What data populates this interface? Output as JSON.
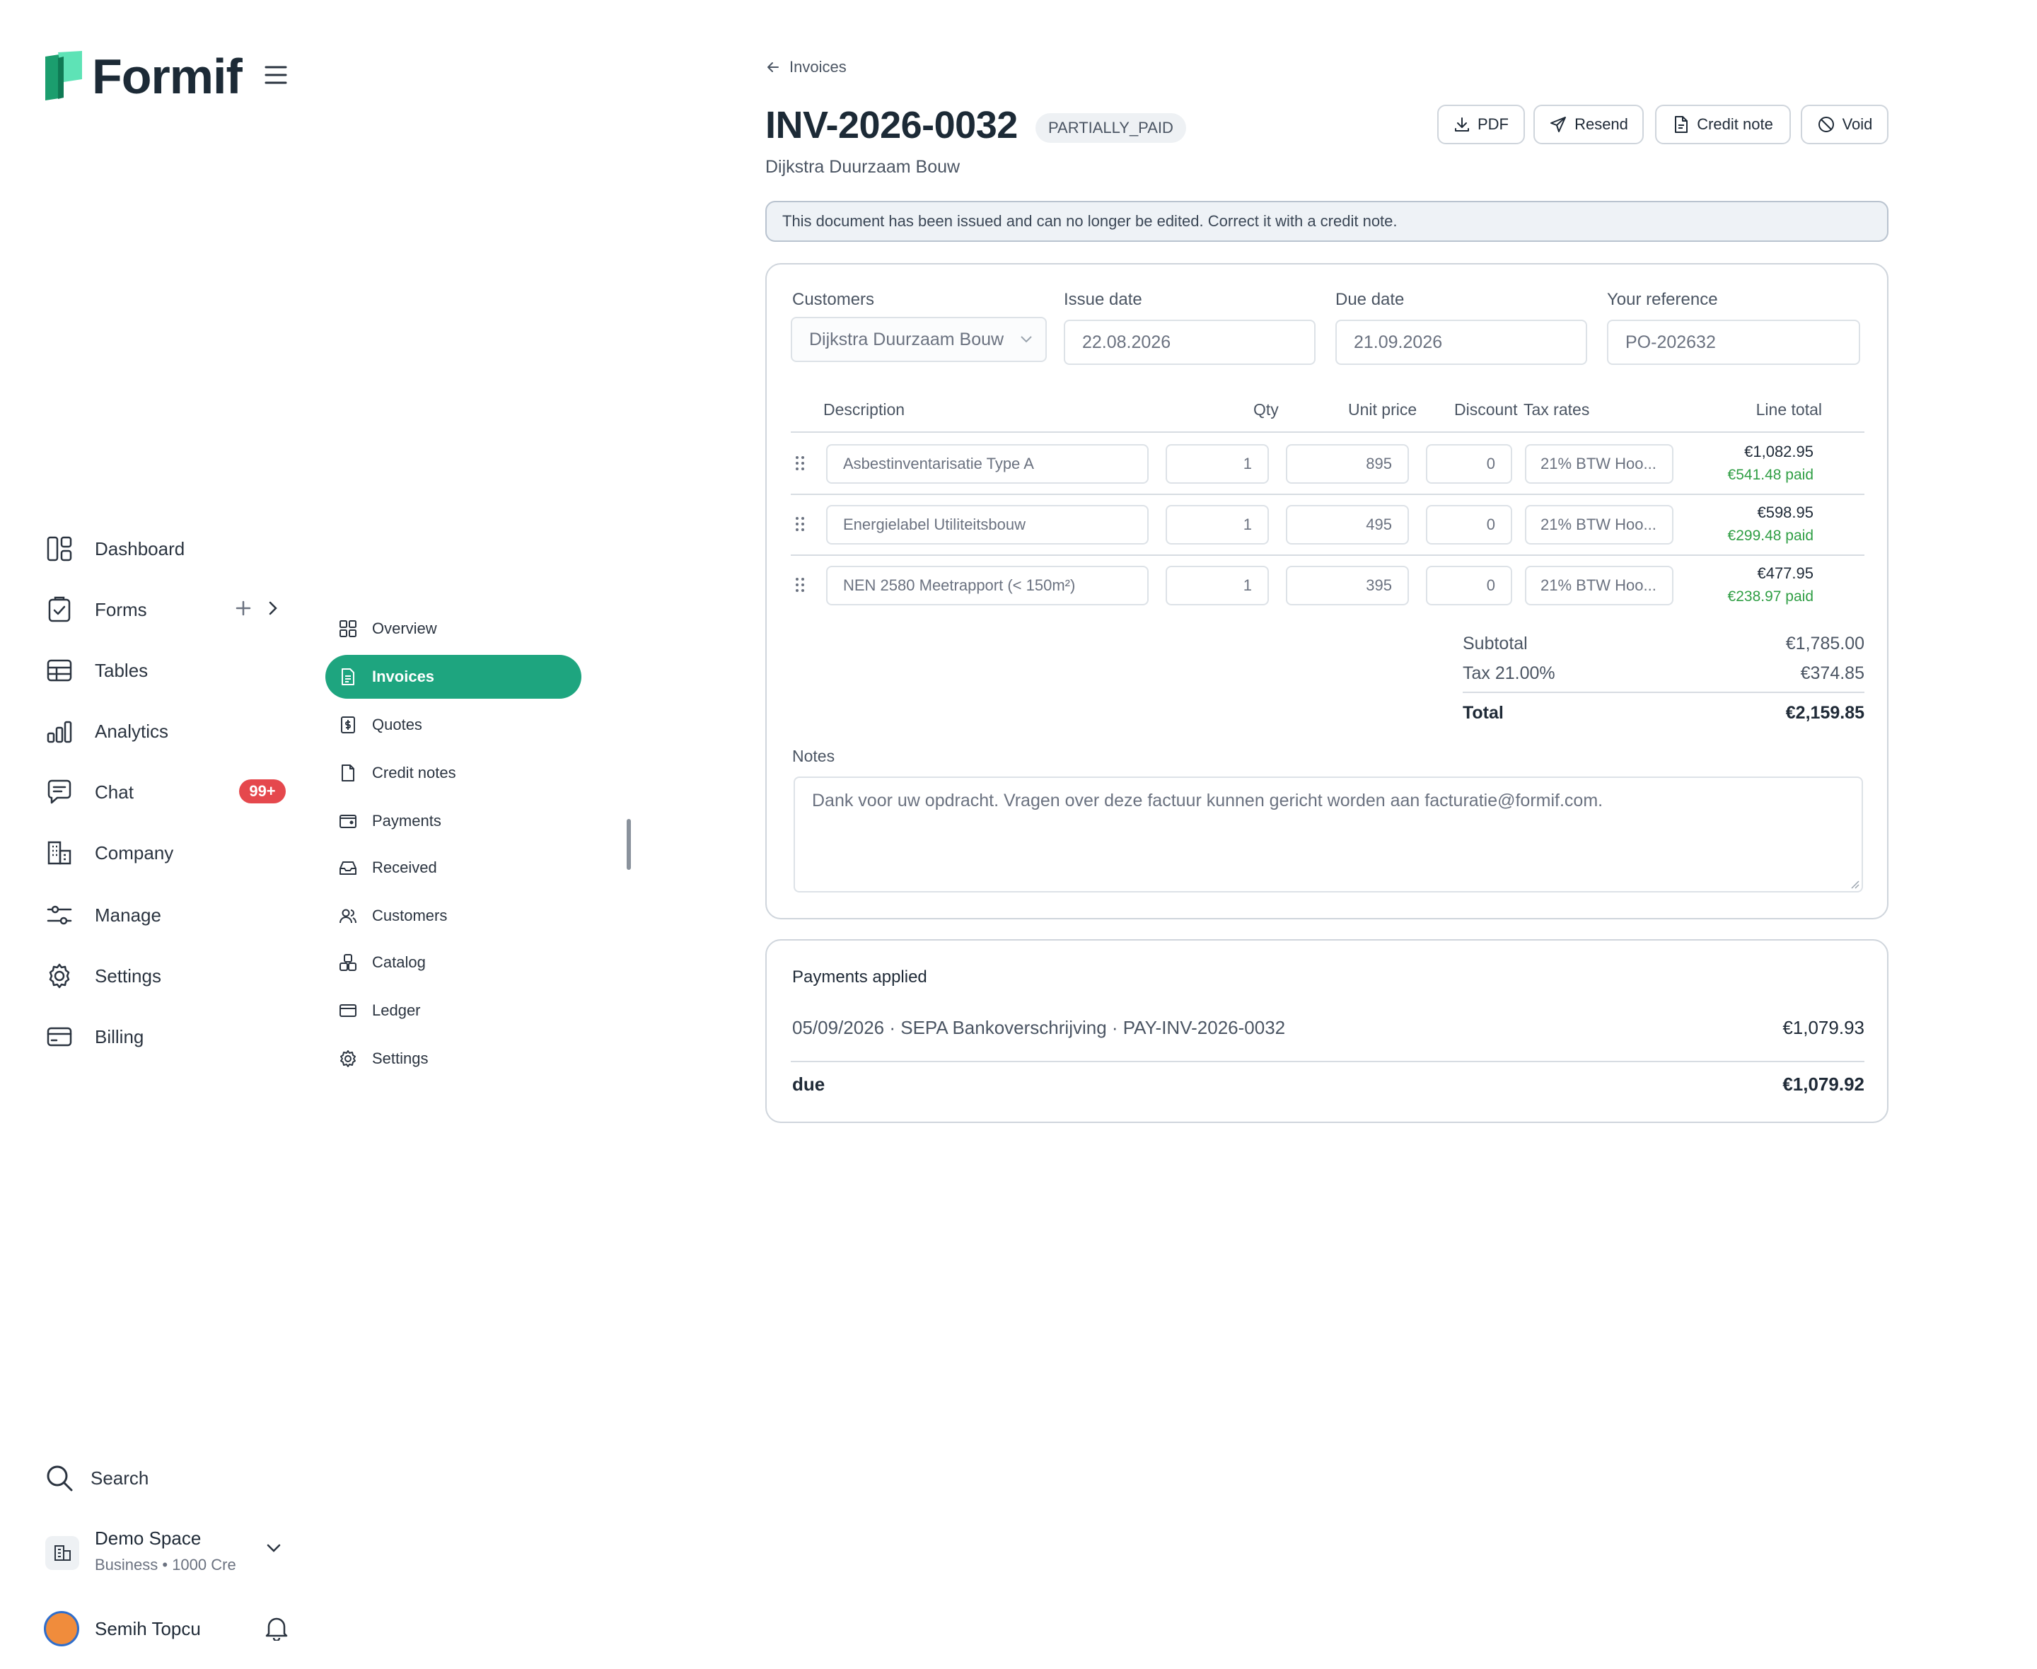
{
  "app": {
    "name": "Formif"
  },
  "nav": {
    "items": [
      {
        "label": "Dashboard",
        "icon": "dashboard-icon"
      },
      {
        "label": "Forms",
        "icon": "forms-icon"
      },
      {
        "label": "Tables",
        "icon": "table-icon"
      },
      {
        "label": "Analytics",
        "icon": "analytics-icon"
      },
      {
        "label": "Chat",
        "icon": "chat-icon",
        "badge": "99+"
      },
      {
        "label": "Company",
        "icon": "building-icon"
      },
      {
        "label": "Manage",
        "icon": "sliders-icon"
      },
      {
        "label": "Settings",
        "icon": "gear-icon"
      },
      {
        "label": "Billing",
        "icon": "credit-card-icon"
      }
    ]
  },
  "subnav": {
    "items": [
      {
        "label": "Overview",
        "icon": "grid-icon"
      },
      {
        "label": "Invoices",
        "icon": "document-icon",
        "active": true
      },
      {
        "label": "Quotes",
        "icon": "dollar-document-icon"
      },
      {
        "label": "Credit notes",
        "icon": "file-icon"
      },
      {
        "label": "Payments",
        "icon": "wallet-icon"
      },
      {
        "label": "Received",
        "icon": "inbox-icon"
      },
      {
        "label": "Customers",
        "icon": "users-icon"
      },
      {
        "label": "Catalog",
        "icon": "boxes-icon"
      },
      {
        "label": "Ledger",
        "icon": "ledger-icon"
      },
      {
        "label": "Settings",
        "icon": "gear-icon"
      }
    ]
  },
  "footer": {
    "search_label": "Search",
    "space": {
      "name": "Demo Space",
      "meta": "Business • 1000 Cre"
    },
    "user": {
      "name": "Semih Topcu"
    }
  },
  "header": {
    "breadcrumb": "Invoices",
    "doc_number": "INV-2026-0032",
    "status": "PARTIALLY_PAID",
    "customer": "Dijkstra Duurzaam Bouw",
    "buttons": {
      "pdf": "PDF",
      "resend": "Resend",
      "credit_note": "Credit note",
      "void": "Void"
    }
  },
  "notice": "This document has been issued and can no longer be edited. Correct it with a credit note.",
  "form": {
    "customers": {
      "label": "Customers",
      "value": "Dijkstra Duurzaam Bouw"
    },
    "issue_date": {
      "label": "Issue date",
      "value": "22.08.2026"
    },
    "due_date": {
      "label": "Due date",
      "value": "21.09.2026"
    },
    "reference": {
      "label": "Your reference",
      "value": "PO-202632"
    }
  },
  "lines": {
    "headers": {
      "description": "Description",
      "qty": "Qty",
      "unit_price": "Unit price",
      "discount": "Discount",
      "tax_rates": "Tax rates",
      "line_total": "Line total"
    },
    "rows": [
      {
        "description": "Asbestinventarisatie Type A",
        "qty": "1",
        "unit_price": "895",
        "discount": "0",
        "tax": "21% BTW Hoo...",
        "total": "€1,082.95",
        "paid": "€541.48 paid"
      },
      {
        "description": "Energielabel Utiliteitsbouw",
        "qty": "1",
        "unit_price": "495",
        "discount": "0",
        "tax": "21% BTW Hoo...",
        "total": "€598.95",
        "paid": "€299.48 paid"
      },
      {
        "description": "NEN 2580 Meetrapport (< 150m²)",
        "qty": "1",
        "unit_price": "395",
        "discount": "0",
        "tax": "21% BTW Hoo...",
        "total": "€477.95",
        "paid": "€238.97 paid"
      }
    ]
  },
  "totals": {
    "subtotal_label": "Subtotal",
    "subtotal": "€1,785.00",
    "tax_label": "Tax 21.00%",
    "tax": "€374.85",
    "total_label": "Total",
    "total": "€2,159.85"
  },
  "notes": {
    "label": "Notes",
    "value": "Dank voor uw opdracht. Vragen over deze factuur kunnen gericht worden aan facturatie@formif.com."
  },
  "payments": {
    "title": "Payments applied",
    "rows": [
      {
        "text": "05/09/2026 · SEPA Bankoverschrijving · PAY-INV-2026-0032",
        "amount": "€1,079.93"
      }
    ],
    "due_label": "due",
    "due_amount": "€1,079.92"
  },
  "colors": {
    "accent": "#1ea57f",
    "badge": "#e5484d",
    "paid": "#2f9e44"
  }
}
